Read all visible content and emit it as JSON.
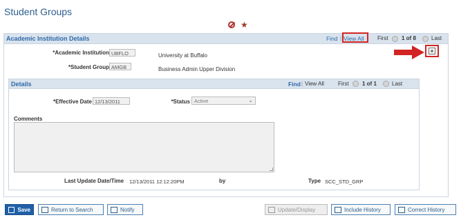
{
  "page": {
    "title": "Student Groups"
  },
  "outer": {
    "title": "Academic Institution Details",
    "find": "Find",
    "view_all": "View All",
    "first": "First",
    "position": "1 of 8",
    "last": "Last",
    "institution_label": "*Academic Institution",
    "institution_value": "UBFLO",
    "institution_desc": "University at Buffalo",
    "group_label": "*Student Group",
    "group_value": "AMGB",
    "group_desc": "Business Admin Upper Division",
    "add_symbol": "+"
  },
  "details": {
    "title": "Details",
    "find": "Find",
    "view_all": "View All",
    "first": "First",
    "position": "1 of 1",
    "last": "Last",
    "effdt_label": "*Effective Date",
    "effdt_value": "12/13/2011",
    "status_label": "*Status",
    "status_value": "Active",
    "comments_label": "Comments",
    "last_update_label": "Last Update Date/Time",
    "last_update_value": "12/13/2011 12:12:20PM",
    "by_label": "by",
    "type_label": "Type",
    "type_value": "SCC_STD_GRP"
  },
  "toolbar": {
    "save": "Save",
    "return_to_search": "Return to Search",
    "notify": "Notify",
    "update_display": "Update/Display",
    "include_history": "Include History",
    "correct_history": "Correct History"
  },
  "colors": {
    "highlight": "#d22424",
    "accent": "#2f6aa8",
    "header_bg": "#d9e3ee"
  }
}
